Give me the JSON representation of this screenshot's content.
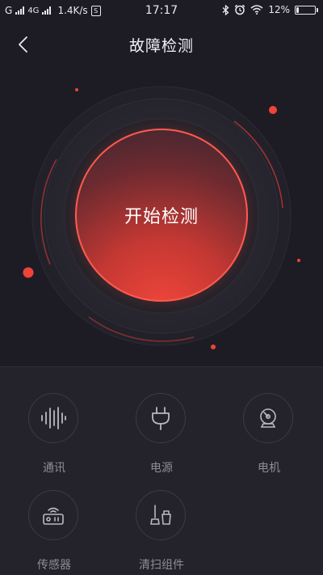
{
  "status_bar": {
    "carrier1": "G",
    "carrier2": "4G",
    "speed": "1.4K/s",
    "sim_badge": "S",
    "time": "17:17",
    "battery": "12%",
    "battery_level": 0.12
  },
  "header": {
    "title": "故障检测",
    "back_icon": "chevron-left-icon"
  },
  "hero": {
    "start_label": "开始检测",
    "accent": "#ef4439"
  },
  "grid": {
    "items": [
      {
        "label": "通讯",
        "icon": "waveform-icon"
      },
      {
        "label": "电源",
        "icon": "plug-icon"
      },
      {
        "label": "电机",
        "icon": "motor-icon"
      },
      {
        "label": "传感器",
        "icon": "sensor-icon"
      },
      {
        "label": "清扫组件",
        "icon": "cleaning-kit-icon"
      }
    ]
  },
  "colors": {
    "background": "#1d1c24",
    "panel": "#24232b",
    "accent": "#ef4439",
    "label": "#8e8d97"
  }
}
